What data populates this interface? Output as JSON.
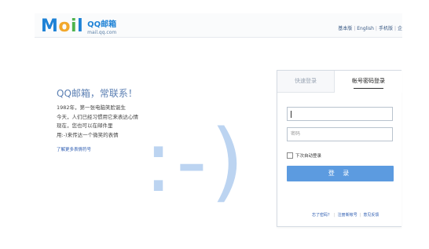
{
  "header": {
    "logo": {
      "m": "M",
      "a": "o",
      "i": "i",
      "l": "l",
      "brand": "QQ邮箱",
      "domain": "mail.qq.com"
    },
    "links": [
      "基本版",
      "English",
      "手机版",
      "企"
    ]
  },
  "intro": {
    "slogan": "QQ邮箱，常联系！",
    "story": [
      "1982年，第一张电脑笑脸诞生",
      "今天，人们已经习惯用它来表达心情",
      "现在，您也可以在邮件里",
      "用:-)来传达一个微笑的表情"
    ],
    "more_link": "了解更多表情符号",
    "smiley": ":-)"
  },
  "login": {
    "tabs": [
      "快速登录",
      "帐号密码登录"
    ],
    "active_tab": 1,
    "account_value": "",
    "password_placeholder": "密码",
    "remember_label": "下次自动登录",
    "remember_checked": false,
    "submit_label": "登 录",
    "footer_links": [
      "忘了密码？",
      "注册新帐号",
      "意见反馈"
    ]
  },
  "colors": {
    "accent": "#5c9be0",
    "smiley": "#bcd4f1",
    "slogan": "#5b7fb3",
    "link": "#2b5bb0"
  }
}
